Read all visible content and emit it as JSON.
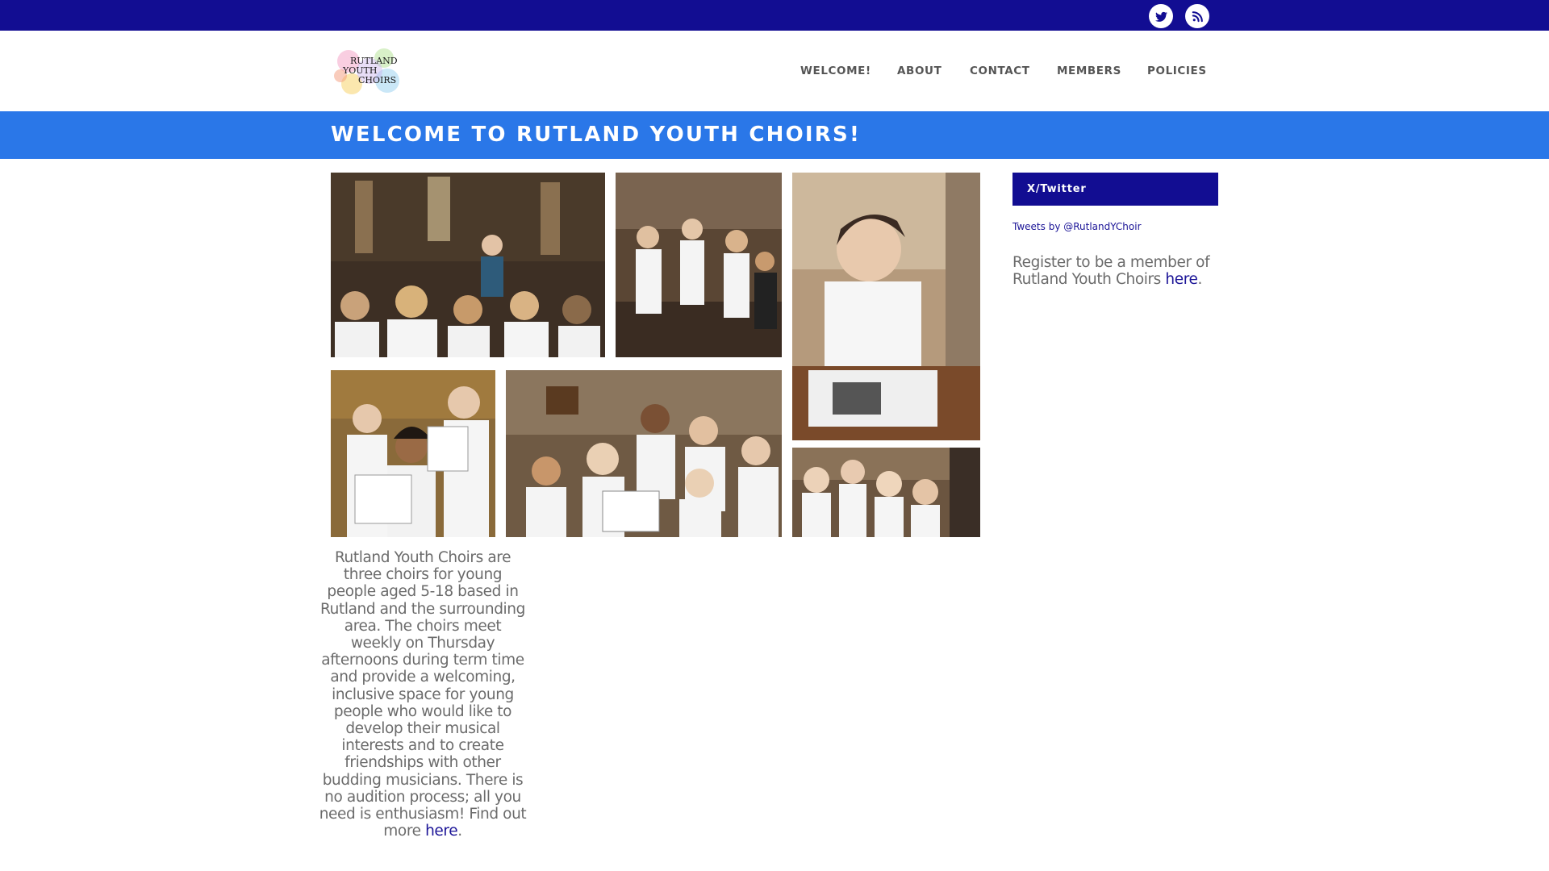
{
  "colors": {
    "topbar": "#120d92",
    "banner": "#2a77e8",
    "link": "#1b1497",
    "text": "#6b6b6b"
  },
  "social": [
    {
      "name": "twitter",
      "icon": "twitter-bird-icon"
    },
    {
      "name": "rss",
      "icon": "rss-feed-icon"
    }
  ],
  "logo": {
    "line1": "RUTLAND",
    "line2": "YOUTH",
    "line3": "CHOIRS"
  },
  "nav": {
    "items": [
      "WELCOME!",
      "ABOUT",
      "CONTACT",
      "MEMBERS",
      "POLICIES"
    ]
  },
  "page": {
    "title": "WELCOME TO RUTLAND YOUTH CHOIRS!"
  },
  "intro": {
    "text": "Rutland Youth Choirs are three choirs for young people aged 5-18 based in Rutland and the surrounding area. The choirs meet weekly on Thursday afternoons during term time and provide a welcoming, inclusive space for young people who would like to develop their musical interests and to create friendships with other budding musicians. There is no audition process; all you need is enthusiasm! Find out more",
    "link": "here",
    "end": "."
  },
  "sidebar": {
    "widget_title": "X/Twitter",
    "tweets_link": "Tweets by @RutlandYChoir",
    "register_text": "Register to be a member of Rutland Youth Choirs",
    "register_link": "here",
    "register_end": "."
  }
}
